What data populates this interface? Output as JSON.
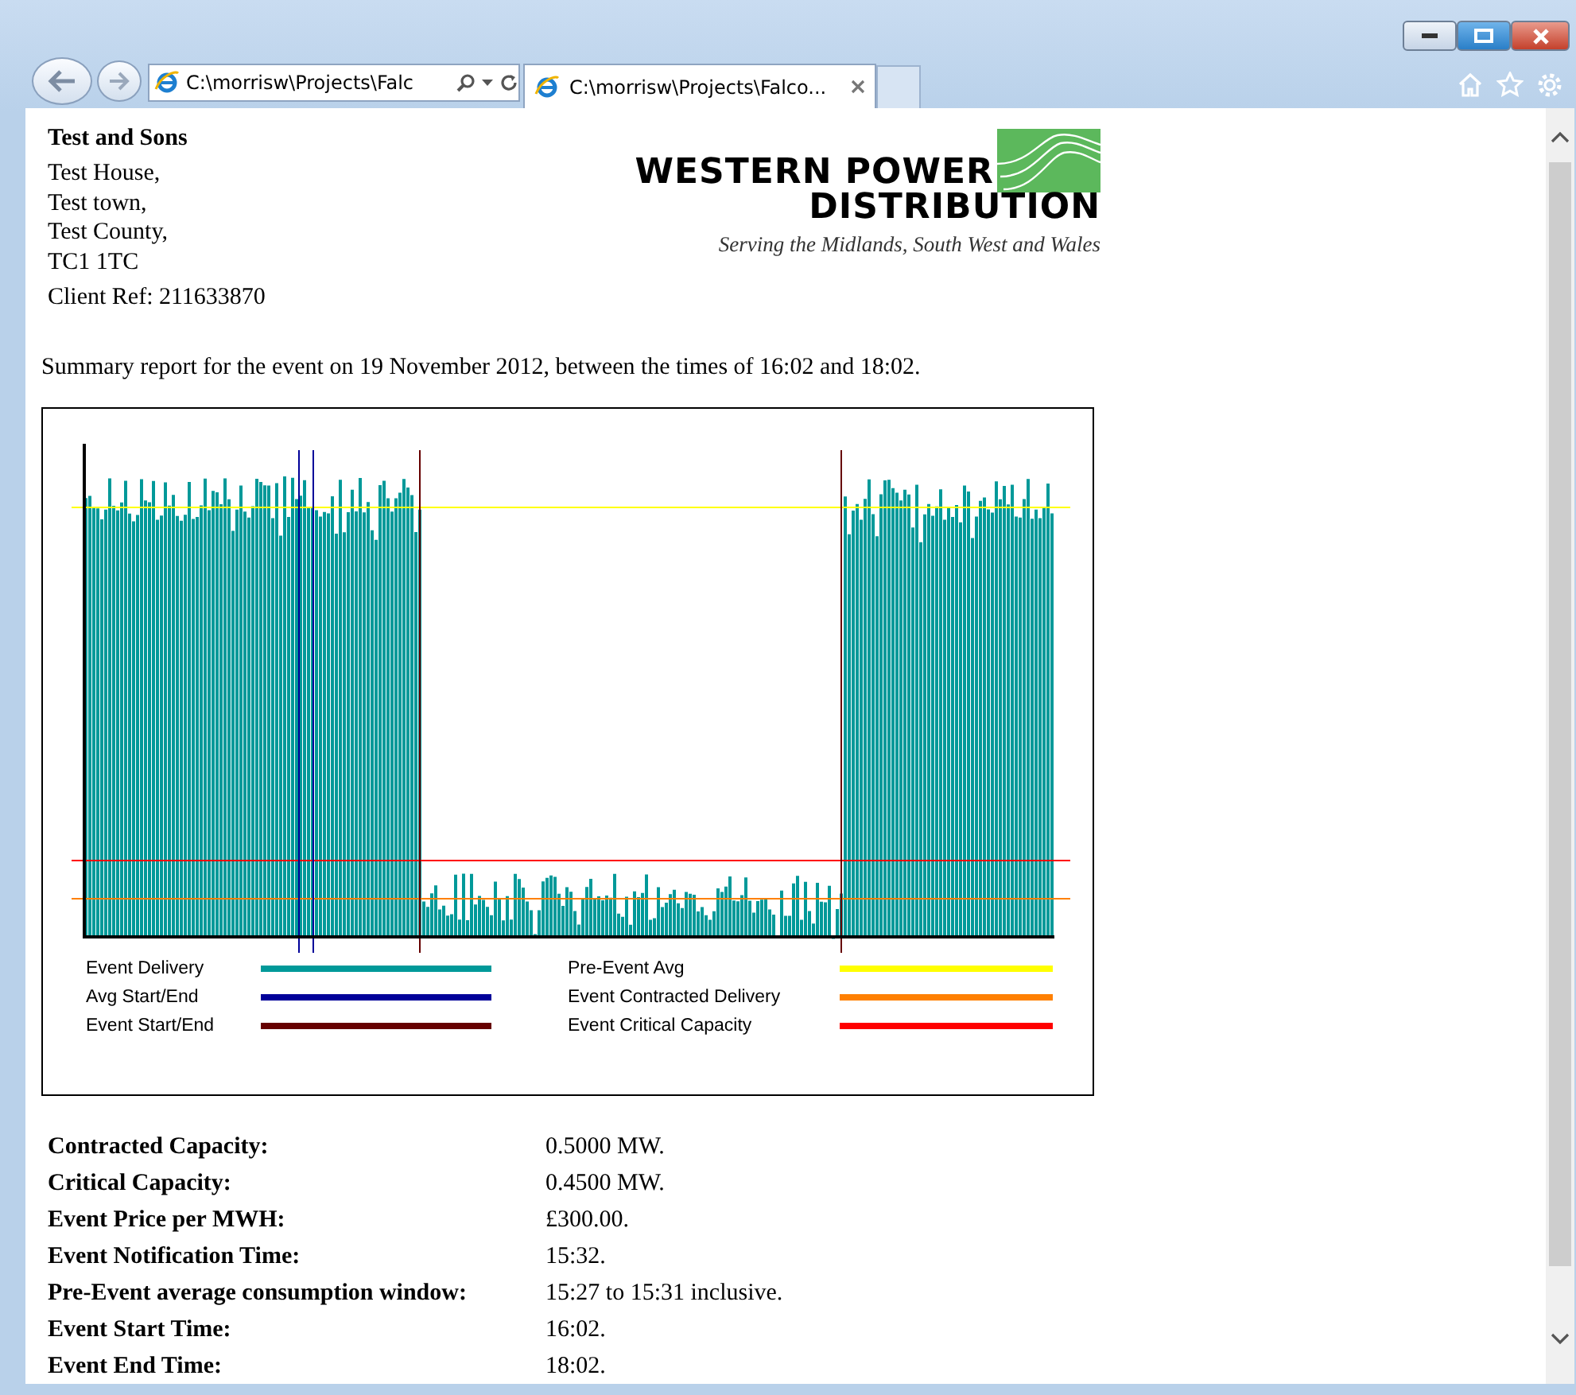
{
  "browser": {
    "address": "C:\\morrisw\\Projects\\Falc",
    "tabs": [
      {
        "title": "C:\\morrisw\\Projects\\Falco...",
        "selected": true
      }
    ]
  },
  "customer": {
    "name": "Test and Sons",
    "address_lines": [
      "Test House,",
      "Test town,",
      "Test County,",
      "TC1 1TC"
    ],
    "client_ref": "Client Ref: 211633870"
  },
  "logo": {
    "line_1": "WESTERN POWER",
    "line_2": "DISTRIBUTION",
    "tagline": "Serving the Midlands, South West and Wales"
  },
  "summary": "Summary report for the event on 19 November 2012, between the times of 16:02 and 18:02.",
  "chart": {
    "legend": [
      {
        "label": "Event Delivery",
        "kind": "delivery",
        "color": "#009999"
      },
      {
        "label": "Pre-Event Avg",
        "kind": "pre_event_avg",
        "color": "#ffff00"
      },
      {
        "label": "Avg Start/End",
        "kind": "avg_window",
        "color": "#000099"
      },
      {
        "label": "Event Contracted Delivery",
        "kind": "contracted",
        "color": "#ff8000"
      },
      {
        "label": "Event Start/End",
        "kind": "event_window",
        "color": "#660000"
      },
      {
        "label": "Event Critical Capacity",
        "kind": "critical",
        "color": "#ff0000"
      }
    ]
  },
  "details": [
    {
      "label": "Contracted Capacity:",
      "value": "0.5000 MW."
    },
    {
      "label": "Critical Capacity:",
      "value": "0.4500 MW."
    },
    {
      "label": "Event Price per MWH:",
      "value": "£300.00."
    },
    {
      "label": "Event Notification Time:",
      "value": "15:32."
    },
    {
      "label": "Pre-Event average consumption window:",
      "value": "15:27 to 15:31 inclusive."
    },
    {
      "label": "Event Start Time:",
      "value": "16:02."
    },
    {
      "label": "Event End Time:",
      "value": "18:02."
    }
  ]
}
